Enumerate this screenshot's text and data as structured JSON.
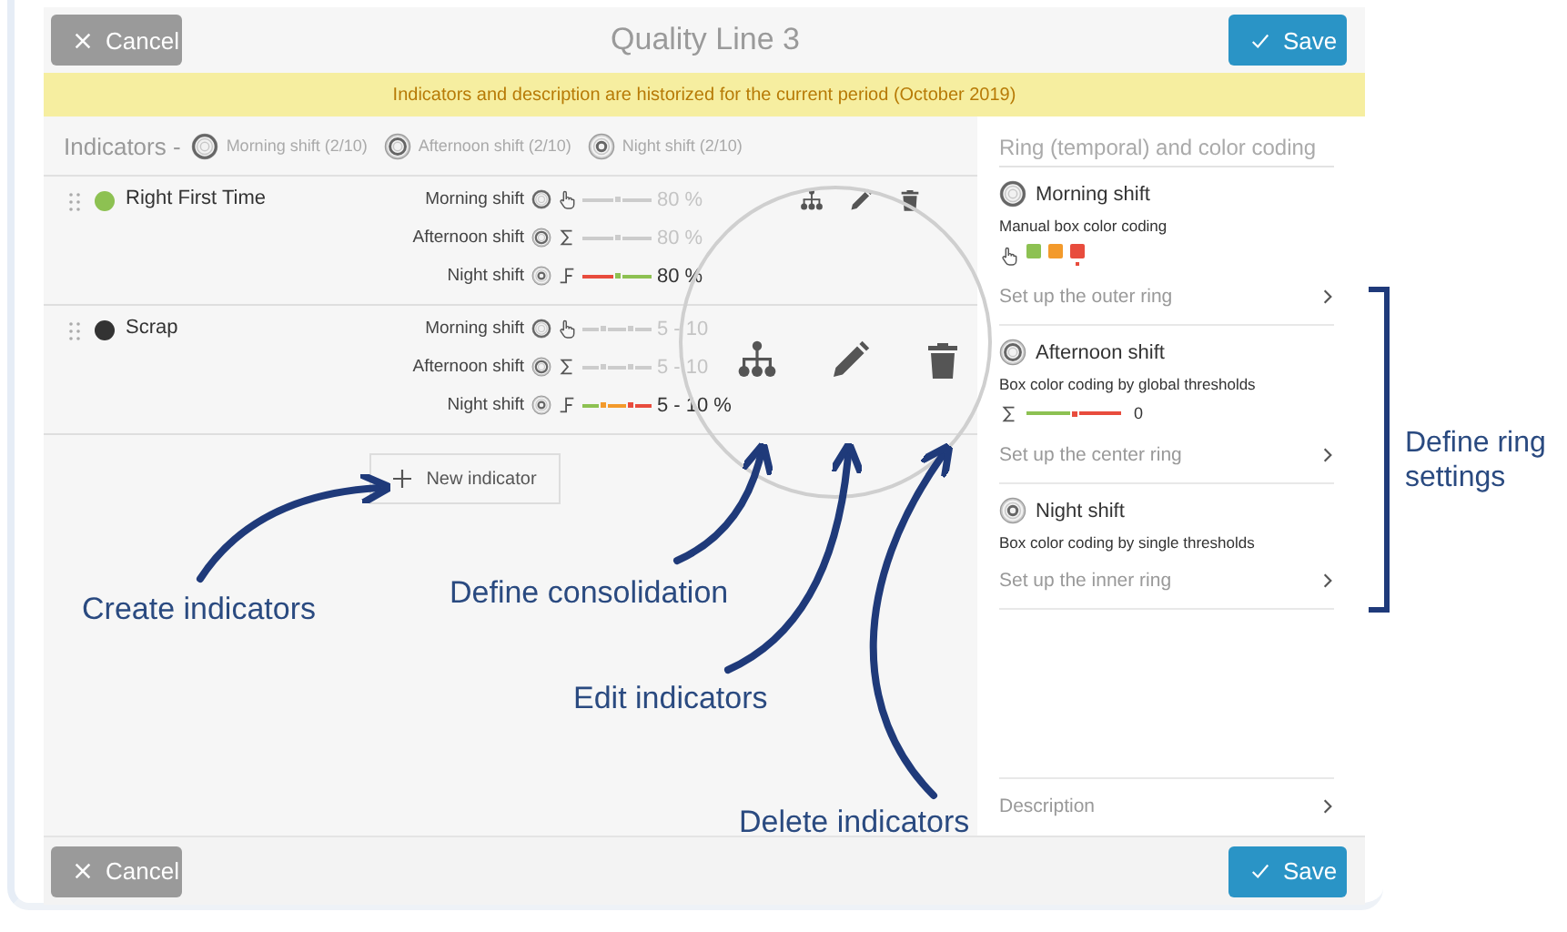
{
  "header": {
    "cancel": "Cancel",
    "title": "Quality Line 3",
    "save": "Save"
  },
  "banner": "Indicators and description are historized for the current period (October 2019)",
  "indicators_header": {
    "label": "Indicators -",
    "shifts": [
      {
        "kind": "outer",
        "label": "Morning shift (2/10)"
      },
      {
        "kind": "center",
        "label": "Afternoon shift (2/10)"
      },
      {
        "kind": "inner",
        "label": "Night shift (2/10)"
      }
    ]
  },
  "indicators": [
    {
      "name": "Right First Time",
      "color": "#8dc152",
      "show_actions": true,
      "shifts": [
        {
          "name": "Morning shift",
          "kind": "manual",
          "active": false,
          "value": "80 %",
          "thresholds": [
            {
              "color": "#cccccc"
            },
            {
              "color": "#cccccc"
            }
          ]
        },
        {
          "name": "Afternoon shift",
          "kind": "global",
          "active": false,
          "value": "80 %",
          "thresholds": [
            {
              "color": "#cccccc"
            },
            {
              "color": "#cccccc"
            }
          ]
        },
        {
          "name": "Night shift",
          "kind": "single",
          "active": true,
          "value": "80 %",
          "thresholds": [
            {
              "color": "#e84c3d"
            },
            {
              "color": "#8dc152"
            }
          ]
        }
      ]
    },
    {
      "name": "Scrap",
      "color": "#333333",
      "show_actions": false,
      "shifts": [
        {
          "name": "Morning shift",
          "kind": "manual",
          "active": false,
          "value": "5 - 10",
          "thresholds": [
            {
              "color": "#cccccc"
            },
            {
              "color": "#cccccc"
            },
            {
              "color": "#cccccc"
            }
          ]
        },
        {
          "name": "Afternoon shift",
          "kind": "global",
          "active": false,
          "value": "5 - 10",
          "thresholds": [
            {
              "color": "#cccccc"
            },
            {
              "color": "#cccccc"
            },
            {
              "color": "#cccccc"
            }
          ]
        },
        {
          "name": "Night shift",
          "kind": "single",
          "active": true,
          "value": "5 - 10 %",
          "thresholds": [
            {
              "color": "#8dc152"
            },
            {
              "color": "#f39a2b"
            },
            {
              "color": "#e84c3d"
            }
          ]
        }
      ]
    }
  ],
  "new_indicator": "New indicator",
  "ring_panel": {
    "title": "Ring (temporal) and color coding",
    "sections": [
      {
        "kind": "manual",
        "name": "Morning shift",
        "coding": "Manual box color coding",
        "swatches": [
          {
            "color": "#8dc152",
            "selected": false
          },
          {
            "color": "#f39a2b",
            "selected": false
          },
          {
            "color": "#e84c3d",
            "selected": true
          }
        ],
        "link": "Set up the outer ring"
      },
      {
        "kind": "global",
        "name": "Afternoon shift",
        "coding": "Box color coding by global thresholds",
        "thresholds": [
          {
            "color": "#8dc152"
          },
          {
            "color": "#e84c3d"
          }
        ],
        "value": "0",
        "link": "Set up the center ring"
      },
      {
        "kind": "single",
        "name": "Night shift",
        "coding": "Box color coding by single thresholds",
        "link": "Set up the inner ring"
      }
    ],
    "description": "Description"
  },
  "footer": {
    "cancel": "Cancel",
    "save": "Save"
  },
  "annotations": [
    {
      "kind": "create",
      "text": "Create indicators"
    },
    {
      "kind": "consolidation",
      "text": "Define consolidation"
    },
    {
      "kind": "edit",
      "text": "Edit indicators"
    },
    {
      "kind": "delete",
      "text": "Delete indicators"
    },
    {
      "kind": "rings",
      "text": "Define ring settings"
    }
  ]
}
